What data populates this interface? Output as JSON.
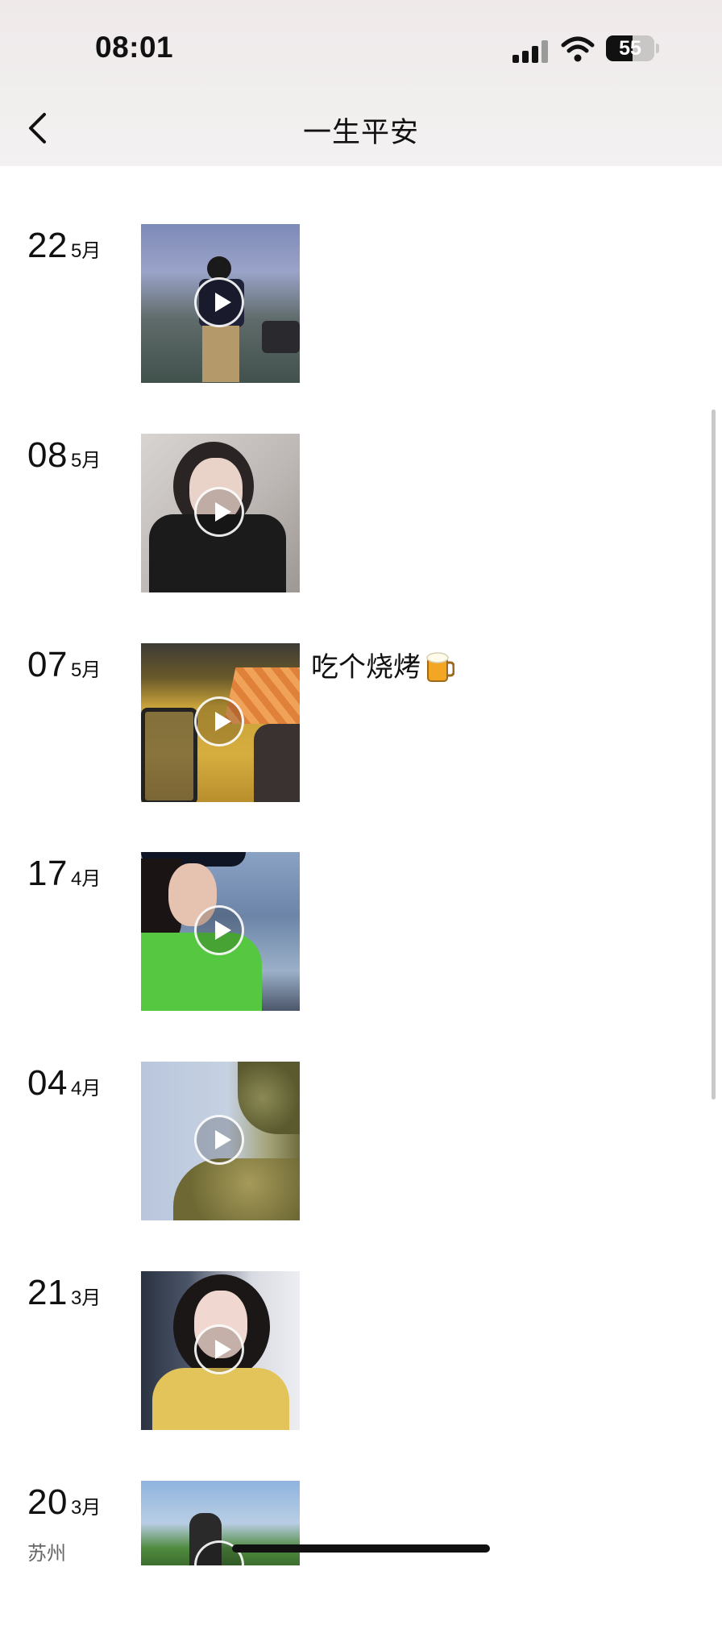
{
  "status_bar": {
    "time": "08:01",
    "battery": "55"
  },
  "header": {
    "title": "一生平安"
  },
  "entries": [
    {
      "day": "22",
      "month": "5月",
      "location": "",
      "caption": ""
    },
    {
      "day": "08",
      "month": "5月",
      "location": "",
      "caption": ""
    },
    {
      "day": "07",
      "month": "5月",
      "location": "",
      "caption": "吃个烧烤"
    },
    {
      "day": "17",
      "month": "4月",
      "location": "",
      "caption": ""
    },
    {
      "day": "04",
      "month": "4月",
      "location": "",
      "caption": ""
    },
    {
      "day": "21",
      "month": "3月",
      "location": "",
      "caption": ""
    },
    {
      "day": "20",
      "month": "3月",
      "location": "苏州",
      "caption": ""
    }
  ],
  "icons": {
    "back": "chevron-left-icon",
    "play": "play-icon",
    "caption_emoji": "beer-mug-icon"
  },
  "colors": {
    "header_bg": "#f1eeee",
    "text": "#111111",
    "location": "#666666"
  }
}
